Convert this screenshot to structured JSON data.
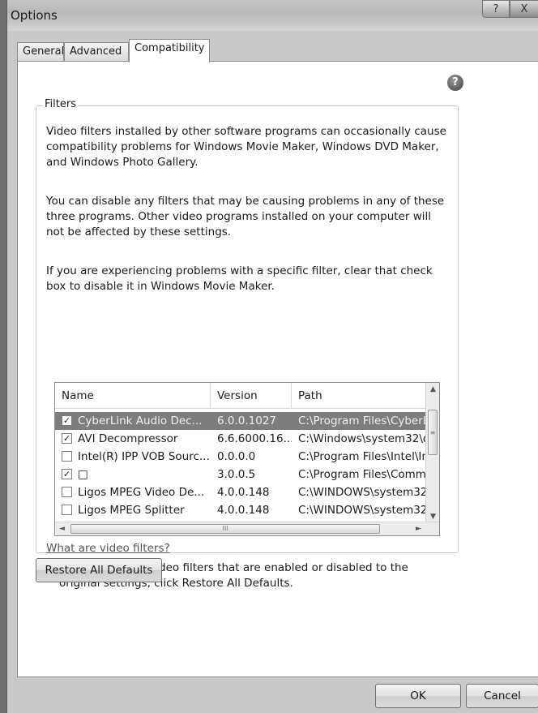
{
  "window": {
    "title": "Options",
    "help_button": "?",
    "close_button": "X"
  },
  "tabs": [
    {
      "label": "General"
    },
    {
      "label": "Advanced"
    },
    {
      "label": "Compatibility",
      "active": true
    }
  ],
  "panel": {
    "help_icon": "?",
    "group_title": "Filters",
    "paragraphs": [
      "Video filters installed by other software programs can occasionally cause compatibility problems for Windows Movie Maker, Windows DVD Maker, and Windows Photo Gallery.",
      "You can disable any filters that may be causing problems in any of these three programs. Other video programs installed on your computer will not be affected by these settings.",
      "If you are experiencing problems with a specific filter, clear that check box to disable it in Windows Movie Maker."
    ],
    "list": {
      "columns": [
        "Name",
        "Version",
        "Path"
      ],
      "rows": [
        {
          "checked": true,
          "selected": true,
          "name": "CyberLink Audio Dec...",
          "version": "6.0.0.1027",
          "path": "C:\\Program Files\\CyberLi"
        },
        {
          "checked": true,
          "selected": false,
          "name": "AVI Decompressor",
          "version": "6.6.6000.16...",
          "path": "C:\\Windows\\system32\\q"
        },
        {
          "checked": false,
          "selected": false,
          "name": "Intel(R) IPP VOB Sourc...",
          "version": "0.0.0.0",
          "path": "C:\\Program Files\\Intel\\In"
        },
        {
          "checked": true,
          "selected": false,
          "name": "□",
          "version": "3.0.0.5",
          "path": "C:\\Program Files\\Commo"
        },
        {
          "checked": false,
          "selected": false,
          "name": "Ligos MPEG Video De...",
          "version": "4.0.0.148",
          "path": "C:\\WINDOWS\\system32\\"
        },
        {
          "checked": false,
          "selected": false,
          "name": "Ligos MPEG Splitter",
          "version": "4.0.0.148",
          "path": "C:\\WINDOWS\\system32\\"
        }
      ],
      "scroll_up": "▲",
      "scroll_down": "▼",
      "scroll_left": "◄",
      "scroll_right": "►",
      "vthumb_grip": "≡",
      "hthumb_grip": "III"
    },
    "link_text": "What are video filters?",
    "note": "To set the list of video filters that are enabled or disabled to the original settings, click Restore All Defaults.",
    "restore_button": "Restore All Defaults"
  },
  "footer": {
    "ok_button": "OK",
    "cancel_button": "Cancel"
  }
}
